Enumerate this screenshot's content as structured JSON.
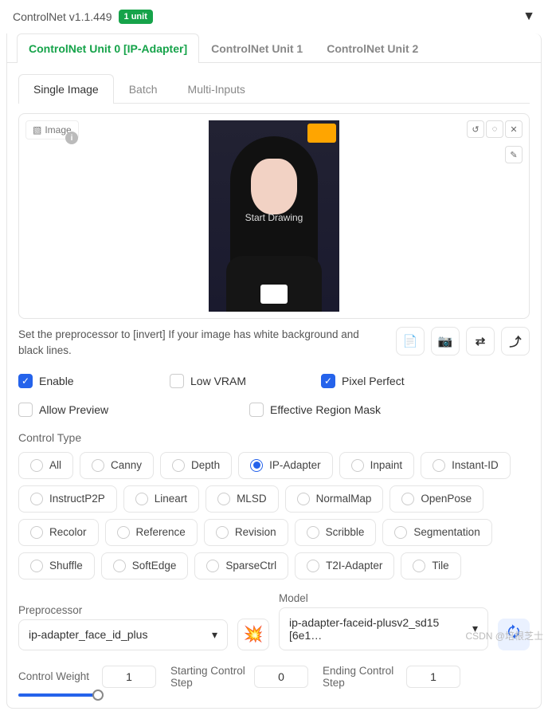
{
  "header": {
    "title": "ControlNet v1.1.449",
    "badge": "1 unit"
  },
  "main_tabs": [
    "ControlNet Unit 0 [IP-Adapter]",
    "ControlNet Unit 1",
    "ControlNet Unit 2"
  ],
  "sub_tabs": [
    "Single Image",
    "Batch",
    "Multi-Inputs"
  ],
  "image_label": "Image",
  "preview_overlay": "Start Drawing",
  "hint": "Set the preprocessor to [invert] If your image has white background and black lines.",
  "checks": {
    "enable": "Enable",
    "low_vram": "Low VRAM",
    "pixel_perfect": "Pixel Perfect",
    "allow_preview": "Allow Preview",
    "effective_region": "Effective Region Mask"
  },
  "control_type_label": "Control Type",
  "control_types": [
    "All",
    "Canny",
    "Depth",
    "IP-Adapter",
    "Inpaint",
    "Instant-ID",
    "InstructP2P",
    "Lineart",
    "MLSD",
    "NormalMap",
    "OpenPose",
    "Recolor",
    "Reference",
    "Revision",
    "Scribble",
    "Segmentation",
    "Shuffle",
    "SoftEdge",
    "SparseCtrl",
    "T2I-Adapter",
    "Tile"
  ],
  "control_type_selected": "IP-Adapter",
  "preprocessor": {
    "label": "Preprocessor",
    "value": "ip-adapter_face_id_plus"
  },
  "model": {
    "label": "Model",
    "value": "ip-adapter-faceid-plusv2_sd15 [6e1…"
  },
  "sliders": {
    "weight": {
      "label": "Control Weight",
      "value": "1"
    },
    "start": {
      "label": "Starting Control Step",
      "value": "0"
    },
    "end": {
      "label": "Ending Control Step",
      "value": "1"
    }
  },
  "watermark": "CSDN @培根芝士"
}
